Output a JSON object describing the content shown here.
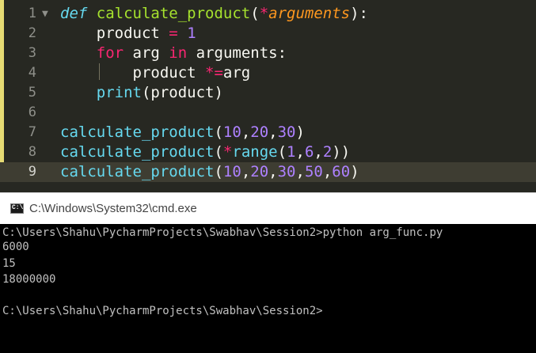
{
  "editor": {
    "lines": [
      {
        "number": "1",
        "fold": "▼",
        "tokens": [
          {
            "t": "def",
            "c": "kw-def"
          },
          {
            "t": " ",
            "c": "ident"
          },
          {
            "t": "calculate_product",
            "c": "fn-name"
          },
          {
            "t": "(",
            "c": "ident"
          },
          {
            "t": "*",
            "c": "op"
          },
          {
            "t": "arguments",
            "c": "param"
          },
          {
            "t": "):",
            "c": "ident"
          }
        ]
      },
      {
        "number": "2",
        "tokens": [
          {
            "t": "    product ",
            "c": "ident"
          },
          {
            "t": "=",
            "c": "op"
          },
          {
            "t": " ",
            "c": "ident"
          },
          {
            "t": "1",
            "c": "num"
          }
        ]
      },
      {
        "number": "3",
        "tokens": [
          {
            "t": "    ",
            "c": "ident"
          },
          {
            "t": "for",
            "c": "op"
          },
          {
            "t": " arg ",
            "c": "ident"
          },
          {
            "t": "in",
            "c": "op"
          },
          {
            "t": " arguments:",
            "c": "ident"
          }
        ]
      },
      {
        "number": "4",
        "tokens": [
          {
            "t": "        product ",
            "c": "ident"
          },
          {
            "t": "*=",
            "c": "op"
          },
          {
            "t": "arg",
            "c": "ident"
          }
        ]
      },
      {
        "number": "5",
        "tokens": [
          {
            "t": "    ",
            "c": "ident"
          },
          {
            "t": "print",
            "c": "builtin"
          },
          {
            "t": "(product)",
            "c": "ident"
          }
        ]
      },
      {
        "number": "6",
        "tokens": []
      },
      {
        "number": "7",
        "tokens": [
          {
            "t": "calculate_product",
            "c": "builtin"
          },
          {
            "t": "(",
            "c": "ident"
          },
          {
            "t": "10",
            "c": "num"
          },
          {
            "t": ",",
            "c": "ident"
          },
          {
            "t": "20",
            "c": "num"
          },
          {
            "t": ",",
            "c": "ident"
          },
          {
            "t": "30",
            "c": "num"
          },
          {
            "t": ")",
            "c": "ident"
          }
        ]
      },
      {
        "number": "8",
        "tokens": [
          {
            "t": "calculate_product",
            "c": "builtin"
          },
          {
            "t": "(",
            "c": "ident"
          },
          {
            "t": "*",
            "c": "op"
          },
          {
            "t": "range",
            "c": "builtin"
          },
          {
            "t": "(",
            "c": "ident"
          },
          {
            "t": "1",
            "c": "num"
          },
          {
            "t": ",",
            "c": "ident"
          },
          {
            "t": "6",
            "c": "num"
          },
          {
            "t": ",",
            "c": "ident"
          },
          {
            "t": "2",
            "c": "num"
          },
          {
            "t": "))",
            "c": "ident"
          }
        ]
      },
      {
        "number": "9",
        "active": true,
        "tokens": [
          {
            "t": "calculate_product",
            "c": "builtin"
          },
          {
            "t": "(",
            "c": "ident"
          },
          {
            "t": "10",
            "c": "num"
          },
          {
            "t": ",",
            "c": "ident"
          },
          {
            "t": "20",
            "c": "num"
          },
          {
            "t": ",",
            "c": "ident"
          },
          {
            "t": "30",
            "c": "num"
          },
          {
            "t": ",",
            "c": "ident"
          },
          {
            "t": "50",
            "c": "num"
          },
          {
            "t": ",",
            "c": "ident"
          },
          {
            "t": "60",
            "c": "num"
          },
          {
            "t": ")",
            "c": "ident"
          }
        ]
      }
    ]
  },
  "cmd": {
    "icon_label": "C:\\",
    "title": "C:\\Windows\\System32\\cmd.exe",
    "output": [
      "C:\\Users\\Shahu\\PycharmProjects\\Swabhav\\Session2>python arg_func.py",
      "6000",
      "15",
      "18000000",
      "",
      "C:\\Users\\Shahu\\PycharmProjects\\Swabhav\\Session2>"
    ]
  },
  "colors": {
    "editor_bg": "#272822",
    "active_line": "#3e3d32",
    "keyword_pink": "#f92672",
    "function_green": "#a6e22e",
    "builtin_cyan": "#66d9ef",
    "number_purple": "#ae81ff",
    "param_orange": "#fd971f",
    "cmd_bg": "#000000",
    "cmd_text": "#c0c0c0"
  }
}
